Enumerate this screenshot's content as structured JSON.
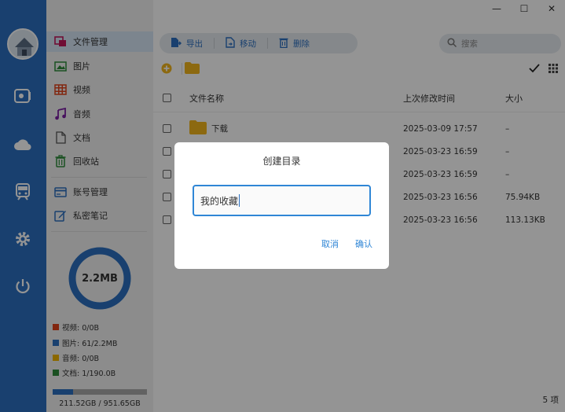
{
  "window": {
    "minimize_glyph": "—",
    "maximize_glyph": "☐",
    "close_glyph": "✕"
  },
  "rail": {
    "icons": [
      "avatar",
      "music-box-icon",
      "cloud-icon",
      "train-icon",
      "gear-icon",
      "power-icon"
    ]
  },
  "sidebar": {
    "items": [
      {
        "label": "文件管理",
        "icon": "file-manager-icon"
      },
      {
        "label": "图片",
        "icon": "image-icon"
      },
      {
        "label": "视频",
        "icon": "video-icon"
      },
      {
        "label": "音频",
        "icon": "music-icon"
      },
      {
        "label": "文档",
        "icon": "document-icon"
      },
      {
        "label": "回收站",
        "icon": "trash-icon"
      },
      {
        "label": "账号管理",
        "icon": "account-icon"
      },
      {
        "label": "私密笔记",
        "icon": "note-icon"
      }
    ],
    "storage": {
      "total_label": "2.2MB",
      "legend": [
        {
          "label": "视频: 0/0B",
          "color": "#e0421b"
        },
        {
          "label": "图片: 61/2.2MB",
          "color": "#2b6fbf"
        },
        {
          "label": "音频: 0/0B",
          "color": "#f0b400"
        },
        {
          "label": "文档: 1/190.0B",
          "color": "#2e8b3a"
        }
      ],
      "usage_fraction": 0.22,
      "usage_text": "211.52GB / 951.65GB"
    }
  },
  "toolbar": {
    "export_label": "导出",
    "move_label": "移动",
    "delete_label": "删除",
    "search_placeholder": "搜索"
  },
  "table": {
    "headers": {
      "name": "文件名称",
      "time": "上次修改时间",
      "size": "大小"
    },
    "rows": [
      {
        "name": "下载",
        "time": "2025-03-09 17:57",
        "size": "–",
        "folder": true
      },
      {
        "name": "",
        "time": "2025-03-23 16:59",
        "size": "–",
        "folder": false
      },
      {
        "name": "",
        "time": "2025-03-23 16:59",
        "size": "–",
        "folder": false
      },
      {
        "name": "",
        "time": "2025-03-23 16:56",
        "size": "75.94KB",
        "folder": false
      },
      {
        "name": "",
        "time": "2025-03-23 16:56",
        "size": "113.13KB",
        "folder": false
      }
    ],
    "count_label": "5 项"
  },
  "dialog": {
    "title": "创建目录",
    "input_value": "我的收藏",
    "cancel_label": "取消",
    "confirm_label": "确认"
  },
  "colors": {
    "accent": "#2b6fbf",
    "dialog_accent": "#2f86d6",
    "folder": "#f2b51c"
  }
}
